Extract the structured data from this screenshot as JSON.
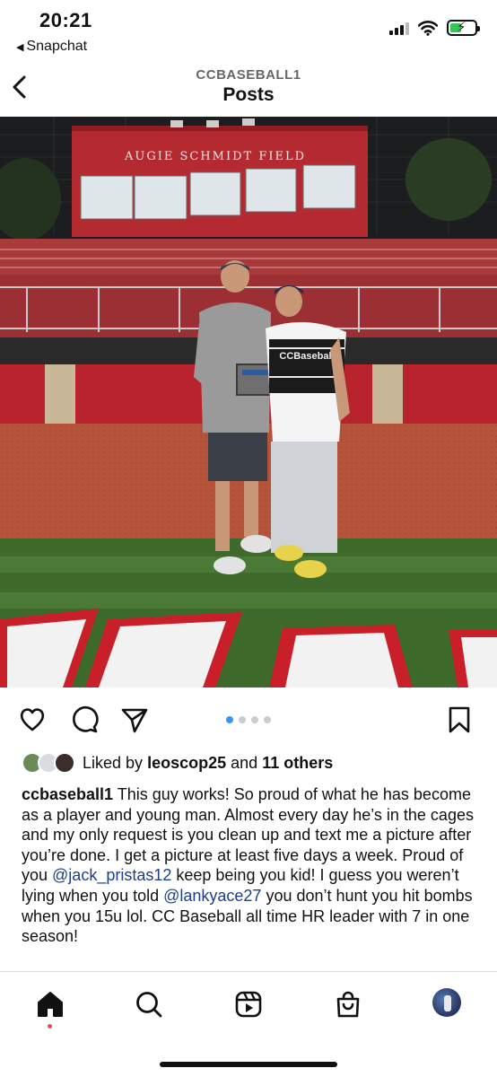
{
  "status_bar": {
    "time": "20:21",
    "back_app": "Snapchat",
    "icons": [
      "cellular-signal-icon",
      "wifi-icon",
      "battery-charging-icon"
    ]
  },
  "header": {
    "username": "CCBASEBALL1",
    "title": "Posts"
  },
  "photo": {
    "scoreboard_text": "AUGIE SCHMIDT FIELD",
    "jersey_text": "CCBaseball"
  },
  "carousel": {
    "total": 4,
    "active": 1
  },
  "likes": {
    "prefix": "Liked by",
    "user": "leoscop25",
    "middle": "and",
    "others": "11 others"
  },
  "caption": {
    "username": "ccbaseball1",
    "part1": " This guy works! So proud of what he has become as a player and young man. Almost every day he’s in the cages and my only request is you clean up and text me a picture after you’re done. I get a picture at least five days a week. Proud of you ",
    "mention1": "@jack_pristas12",
    "part2": " keep being you kid! I guess you weren’t lying when you told ",
    "mention2": "@lankyace27",
    "part3": " you don’t hunt you hit bombs when you 15u lol. CC Baseball all time HR leader with 7 in one season!"
  },
  "colors": {
    "accent": "#3897f0",
    "mention": "#1c3f87",
    "notification": "#ed4956",
    "battery": "#34c759"
  }
}
